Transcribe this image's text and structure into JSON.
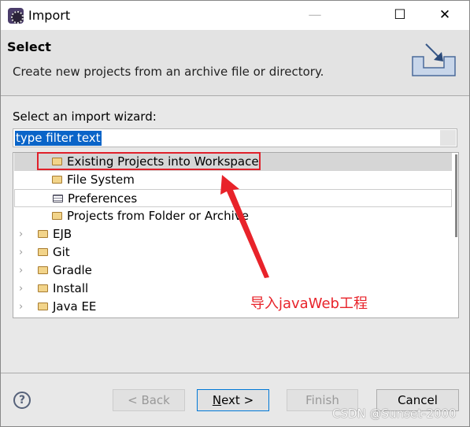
{
  "window": {
    "title": "Import"
  },
  "header": {
    "title": "Select",
    "description": "Create new projects from an archive file or directory."
  },
  "wizard": {
    "label": "Select an import wizard:",
    "filter_value": "type filter text",
    "items": [
      {
        "label": "Existing Projects into Workspace",
        "icon": "import-project-icon",
        "depth": 1,
        "selected": true
      },
      {
        "label": "File System",
        "icon": "folder-icon",
        "depth": 1
      },
      {
        "label": "Preferences",
        "icon": "preferences-icon",
        "depth": 1
      },
      {
        "label": "Projects from Folder or Archive",
        "icon": "folder-icon",
        "depth": 1
      },
      {
        "label": "EJB",
        "icon": "folder-icon",
        "depth": 0,
        "expandable": true
      },
      {
        "label": "Git",
        "icon": "folder-icon",
        "depth": 0,
        "expandable": true
      },
      {
        "label": "Gradle",
        "icon": "folder-icon",
        "depth": 0,
        "expandable": true
      },
      {
        "label": "Install",
        "icon": "folder-icon",
        "depth": 0,
        "expandable": true
      },
      {
        "label": "Java EE",
        "icon": "folder-icon",
        "depth": 0,
        "expandable": true
      }
    ]
  },
  "annotation": {
    "text": "导入javaWeb工程",
    "color": "#e8232a"
  },
  "buttons": {
    "back": "< Back",
    "next_mnemonic": "N",
    "next_rest": "ext >",
    "finish": "Finish",
    "cancel": "Cancel",
    "help": "?"
  },
  "watermark": "CSDN @Sunset-2000"
}
